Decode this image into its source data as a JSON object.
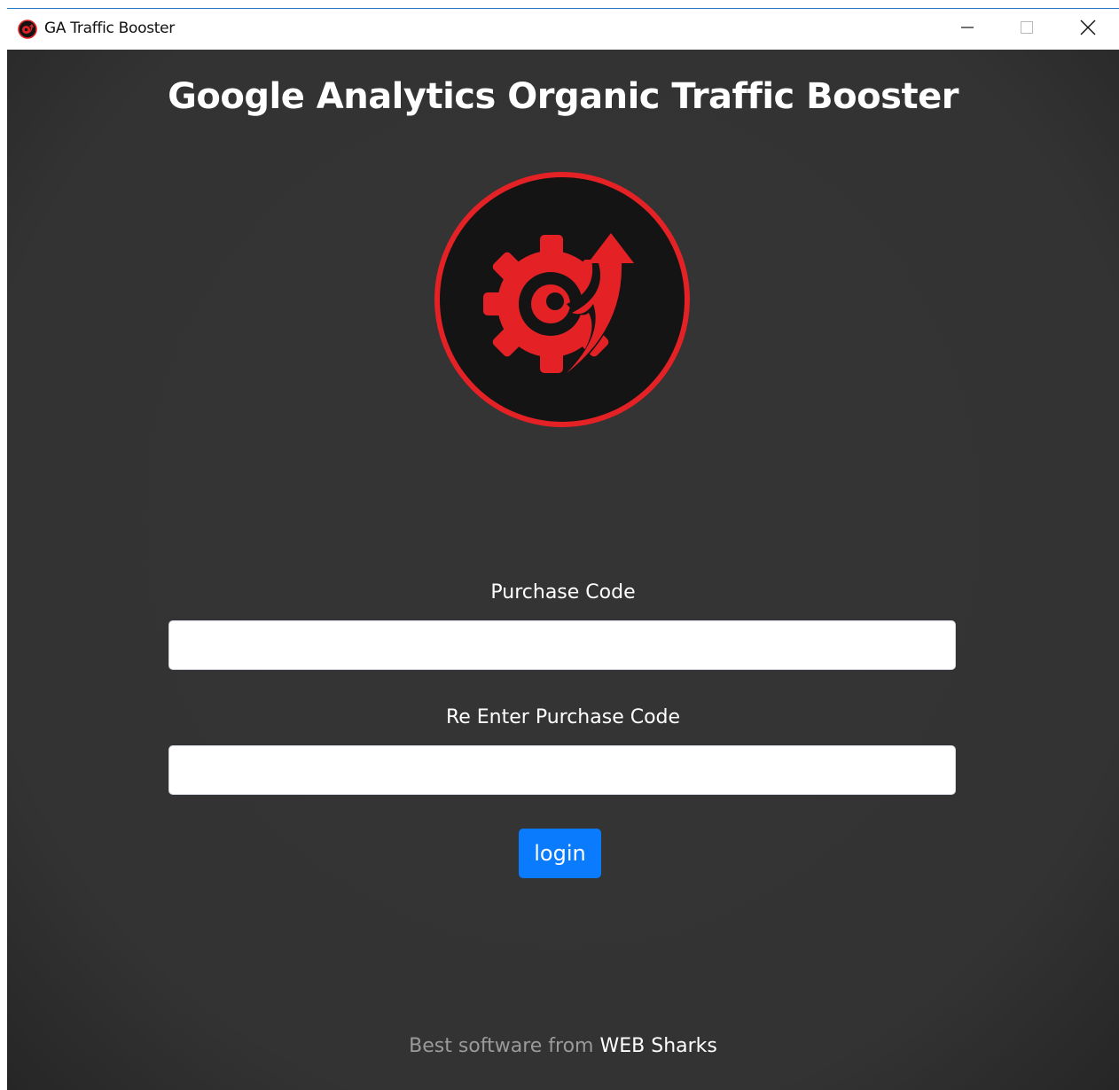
{
  "window": {
    "title": "GA Traffic Booster",
    "app_icon": "ga-booster-logo-icon",
    "controls": {
      "minimize_icon": "minimize-icon",
      "maximize_icon": "maximize-icon",
      "close_icon": "close-icon"
    },
    "accent_border_color": "#2b78c2"
  },
  "main": {
    "title": "Google Analytics Organic Traffic Booster",
    "logo_icon": "gear-arrow-logo",
    "colors": {
      "background": "#333333",
      "logo_red": "#e42226",
      "logo_dark": "#141414",
      "button_blue": "#0b7bfd"
    }
  },
  "form": {
    "purchase_code_label": "Purchase Code",
    "purchase_code_value": "",
    "purchase_code_placeholder": "",
    "reenter_label": "Re Enter Purchase Code",
    "reenter_value": "",
    "reenter_placeholder": "",
    "login_label": "login"
  },
  "footer": {
    "prefix": "Best software from",
    "brand": "WEB Sharks"
  }
}
